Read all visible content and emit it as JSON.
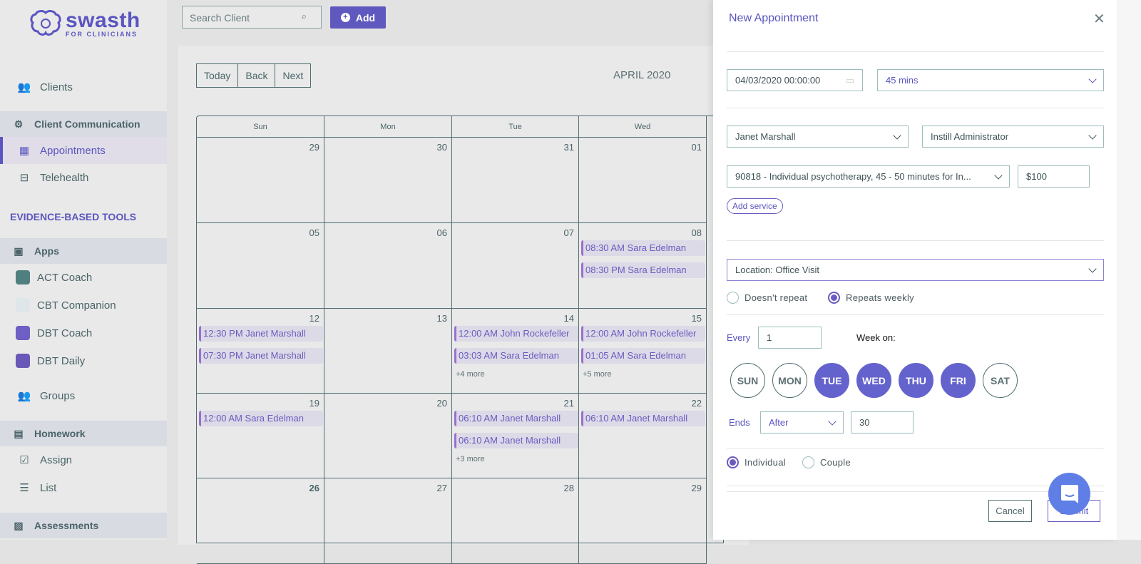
{
  "brand": {
    "name": "swasth",
    "tagline": "FOR CLINICIANS"
  },
  "sidebar": {
    "clients": "Clients",
    "client_communication": "Client Communication",
    "appointments": "Appointments",
    "telehealth": "Telehealth",
    "section": "EVIDENCE-BASED TOOLS",
    "apps": "Apps",
    "act": "ACT Coach",
    "cbt": "CBT Companion",
    "dbt_coach": "DBT Coach",
    "dbt_daily": "DBT Daily",
    "groups": "Groups",
    "homework": "Homework",
    "assign": "Assign",
    "list": "List",
    "assessments": "Assessments"
  },
  "toolbar": {
    "search_placeholder": "Search Client",
    "add_label": "Add"
  },
  "calendar": {
    "today": "Today",
    "back": "Back",
    "next": "Next",
    "month": "APRIL 2020",
    "days": [
      "Sun",
      "Mon",
      "Tue",
      "Wed"
    ],
    "weeks": [
      {
        "dates": [
          "29",
          "30",
          "31",
          "01"
        ],
        "events": [
          [],
          [],
          [],
          []
        ],
        "more": [
          "",
          "",
          "",
          ""
        ]
      },
      {
        "dates": [
          "05",
          "06",
          "07",
          "08"
        ],
        "events": [
          [],
          [],
          [],
          [
            "08:30 AM Sara Edelman",
            "08:30 PM Sara Edelman"
          ]
        ],
        "more": [
          "",
          "",
          "",
          ""
        ]
      },
      {
        "dates": [
          "12",
          "13",
          "14",
          "15"
        ],
        "events": [
          [
            "12:30 PM Janet Marshall",
            "07:30 PM Janet Marshall"
          ],
          [],
          [
            "12:00 AM John Rockefeller",
            "03:03 AM Sara Edelman"
          ],
          [
            "12:00 AM John Rockefeller",
            "01:05 AM Sara Edelman"
          ]
        ],
        "more": [
          "",
          "",
          "+4 more",
          "+5 more"
        ]
      },
      {
        "dates": [
          "19",
          "20",
          "21",
          "22"
        ],
        "events": [
          [
            "12:00 AM Sara Edelman"
          ],
          [],
          [
            "06:10 AM Janet Marshall",
            "06:10 AM Janet Marshall"
          ],
          [
            "06:10 AM Janet Marshall"
          ]
        ],
        "more": [
          "",
          "",
          "+3 more",
          ""
        ]
      },
      {
        "dates": [
          "26",
          "27",
          "28",
          "29"
        ],
        "events": [
          [],
          [],
          [],
          []
        ],
        "more": [
          "",
          "",
          "",
          ""
        ]
      }
    ]
  },
  "panel": {
    "title": "New Appointment",
    "datetime": "04/03/2020 00:00:00",
    "duration": "45 mins",
    "client": "Janet Marshall",
    "provider": "Instill Administrator",
    "service": "90818 - Individual psychotherapy, 45 - 50 minutes for In...",
    "price": "$100",
    "add_service": "Add service",
    "location": "Location: Office Visit",
    "repeat_none": "Doesn't repeat",
    "repeat_weekly": "Repeats weekly",
    "repeat_selected": "Repeats weekly",
    "every_label": "Every",
    "every_value": "1",
    "week_on": "Week on:",
    "weekdays": [
      {
        "l": "SUN",
        "on": false
      },
      {
        "l": "MON",
        "on": false
      },
      {
        "l": "TUE",
        "on": true
      },
      {
        "l": "WED",
        "on": true
      },
      {
        "l": "THU",
        "on": true
      },
      {
        "l": "FRI",
        "on": true
      },
      {
        "l": "SAT",
        "on": false
      }
    ],
    "ends_label": "Ends",
    "ends_value": "After",
    "ends_count": "30",
    "type_individual": "Individual",
    "type_couple": "Couple",
    "type_selected": "Individual",
    "cancel": "Cancel",
    "submit": "Submit"
  },
  "colors": {
    "accent": "#5a55c0",
    "event_bg": "#dcdae6",
    "event_border": "#9a6fcf",
    "chat": "#5f7ee6"
  }
}
